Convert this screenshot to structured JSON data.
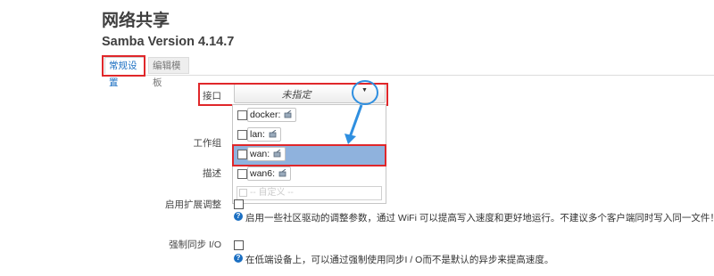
{
  "page": {
    "title": "网络共享",
    "subtitle": "Samba Version 4.14.7"
  },
  "tabs": [
    {
      "label": "常规设置",
      "active": true
    },
    {
      "label": "编辑模板",
      "active": false
    }
  ],
  "form": {
    "interface": {
      "label": "接口",
      "value": "未指定",
      "options": [
        {
          "label": "docker:",
          "checked": false
        },
        {
          "label": "lan:",
          "checked": false
        },
        {
          "label": "wan:",
          "checked": false,
          "highlighted": true
        },
        {
          "label": "wan6:",
          "checked": false
        }
      ],
      "custom_placeholder": "-- 自定义 --"
    },
    "workgroup": {
      "label": "工作组"
    },
    "description": {
      "label": "描述"
    },
    "macos": {
      "label": "启用扩展调整",
      "checked": false,
      "help_icon": "?",
      "help": "启用一些社区驱动的调整参数，通过 WiFi 可以提高写入速度和更好地运行。不建议多个客户端同时写入同一文件！"
    },
    "sync_io": {
      "label": "强制同步 I/O",
      "checked": false,
      "help_icon": "?",
      "help": "在低端设备上，可以通过强制使用同步I / O而不是默认的异步来提高速度。"
    }
  },
  "colors": {
    "accent": "#1b6fc2",
    "highlight": "#e0272a",
    "selected_row": "#8fb2dd",
    "annotation": "#2f8fe0"
  }
}
